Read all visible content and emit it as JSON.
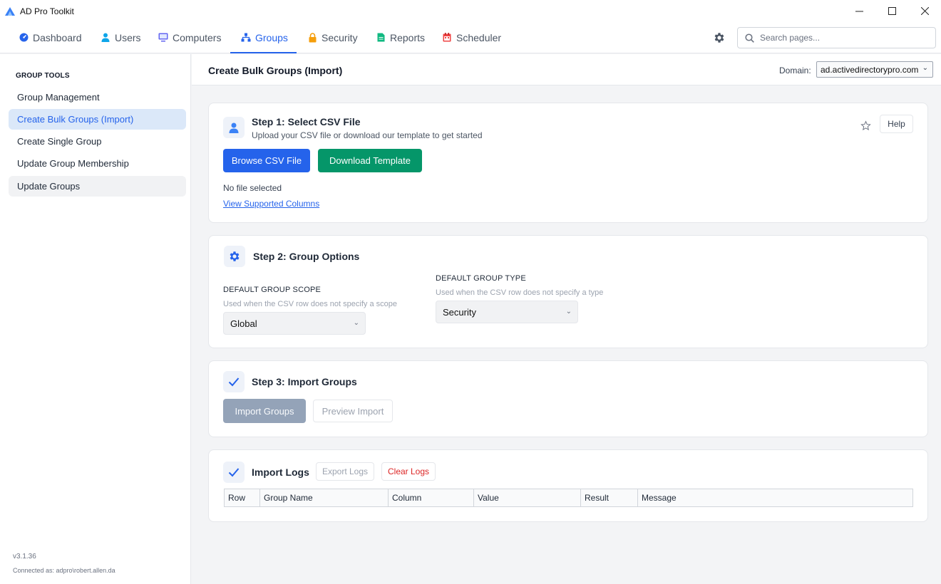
{
  "window": {
    "title": "AD Pro Toolkit",
    "minimize": "—",
    "maximize": "☐",
    "close": "✕"
  },
  "nav": {
    "tabs": [
      {
        "label": "Dashboard",
        "icon": "dashboard-icon"
      },
      {
        "label": "Users",
        "icon": "user-icon"
      },
      {
        "label": "Computers",
        "icon": "monitor-icon"
      },
      {
        "label": "Groups",
        "icon": "groups-icon",
        "active": true
      },
      {
        "label": "Security",
        "icon": "lock-icon"
      },
      {
        "label": "Reports",
        "icon": "report-icon"
      },
      {
        "label": "Scheduler",
        "icon": "calendar-icon"
      }
    ],
    "search_placeholder": "Search pages..."
  },
  "sidebar": {
    "heading": "GROUP TOOLS",
    "items": [
      {
        "label": "Group Management"
      },
      {
        "label": "Create Bulk Groups (Import)",
        "active": true
      },
      {
        "label": "Create Single Group"
      },
      {
        "label": "Update Group Membership"
      },
      {
        "label": "Update Groups"
      }
    ],
    "version": "v3.1.36",
    "connected": "Connected as: adpro\\robert.allen.da"
  },
  "header": {
    "title": "Create Bulk Groups (Import)",
    "domain_label": "Domain:",
    "domain_value": "ad.activedirectorypro.com"
  },
  "step1": {
    "title": "Step 1: Select CSV File",
    "subtitle": "Upload your CSV file or download our template to get started",
    "help": "Help",
    "browse": "Browse CSV File",
    "download": "Download Template",
    "file_status": "No file selected",
    "columns_link": "View Supported Columns"
  },
  "step2": {
    "title": "Step 2: Group Options",
    "scope_label": "DEFAULT GROUP SCOPE",
    "scope_help": "Used when the CSV row does not specify a scope",
    "scope_value": "Global",
    "type_label": "DEFAULT GROUP TYPE",
    "type_help": "Used when the CSV row does not specify a type",
    "type_value": "Security"
  },
  "step3": {
    "title": "Step 3: Import Groups",
    "import": "Import Groups",
    "preview": "Preview Import"
  },
  "logs": {
    "title": "Import Logs",
    "export": "Export Logs",
    "clear": "Clear Logs",
    "columns": [
      "Row",
      "Group Name",
      "Column",
      "Value",
      "Result",
      "Message"
    ]
  },
  "colors": {
    "accent": "#2563eb",
    "success": "#059669",
    "danger": "#dc2626"
  }
}
